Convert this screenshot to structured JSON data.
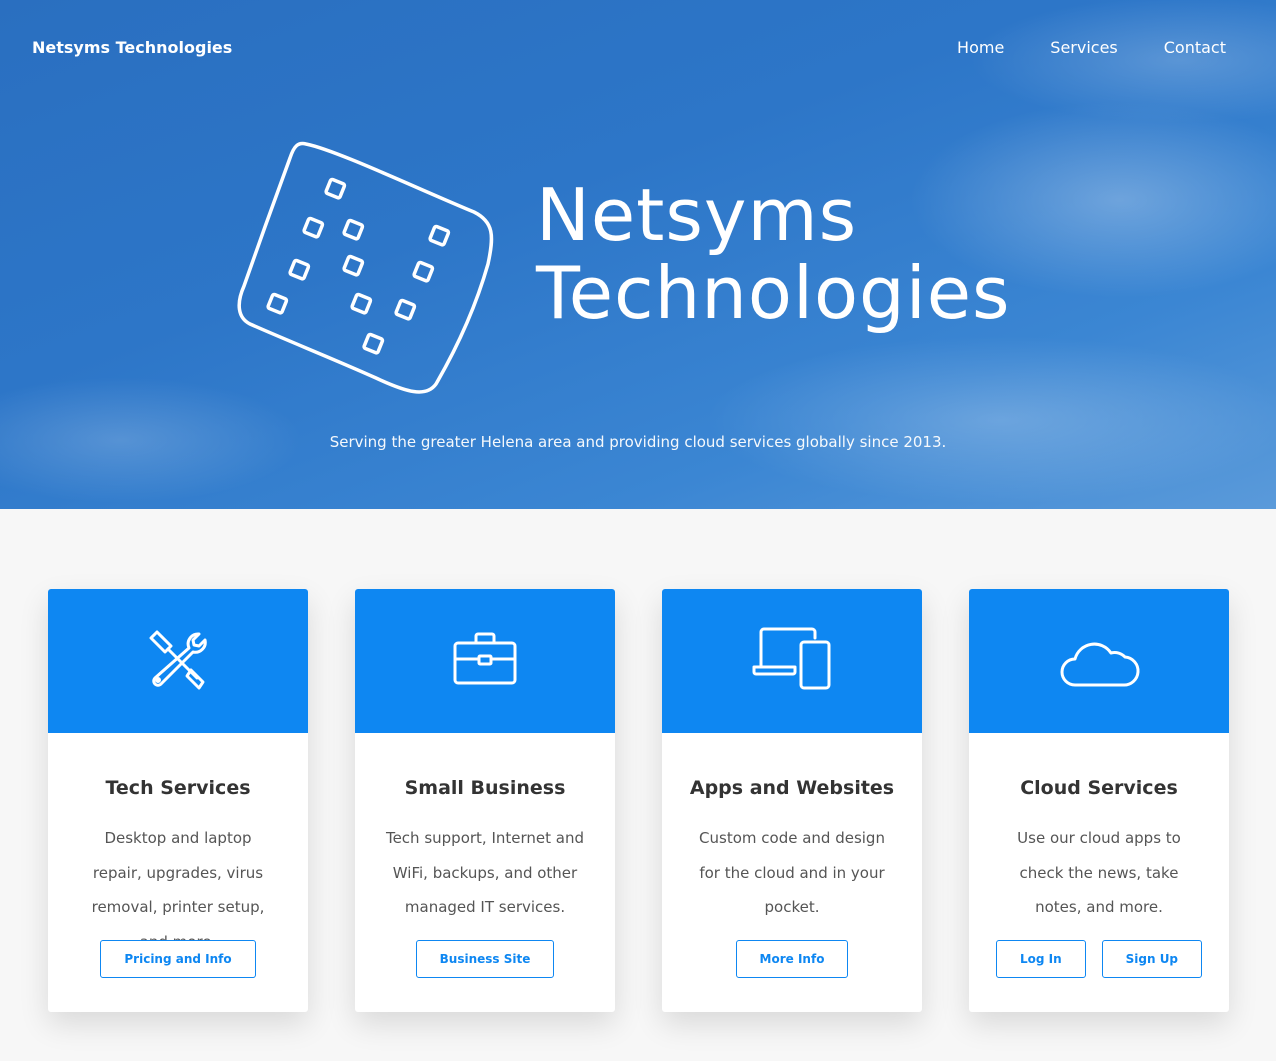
{
  "nav": {
    "brand": "Netsyms Technologies",
    "links": [
      "Home",
      "Services",
      "Contact"
    ]
  },
  "hero": {
    "title_line1": "Netsyms",
    "title_line2": "Technologies",
    "tagline": "Serving the greater Helena area and providing cloud services globally since 2013."
  },
  "cards": [
    {
      "icon": "tools-icon",
      "title": "Tech Services",
      "text": "Desktop and laptop repair, upgrades, virus removal, printer setup, and more.",
      "buttons": [
        "Pricing and Info"
      ]
    },
    {
      "icon": "briefcase-icon",
      "title": "Small Business",
      "text": "Tech support, Internet and WiFi, backups, and other managed IT services.",
      "buttons": [
        "Business Site"
      ]
    },
    {
      "icon": "devices-icon",
      "title": "Apps and Websites",
      "text": "Custom code and design for the cloud and in your pocket.",
      "buttons": [
        "More Info"
      ]
    },
    {
      "icon": "cloud-icon",
      "title": "Cloud Services",
      "text": "Use our cloud apps to check the news, take notes, and more.",
      "buttons": [
        "Log In",
        "Sign Up"
      ]
    }
  ],
  "colors": {
    "accent": "#0e87f2",
    "hero_blue": "#2d76c8"
  }
}
